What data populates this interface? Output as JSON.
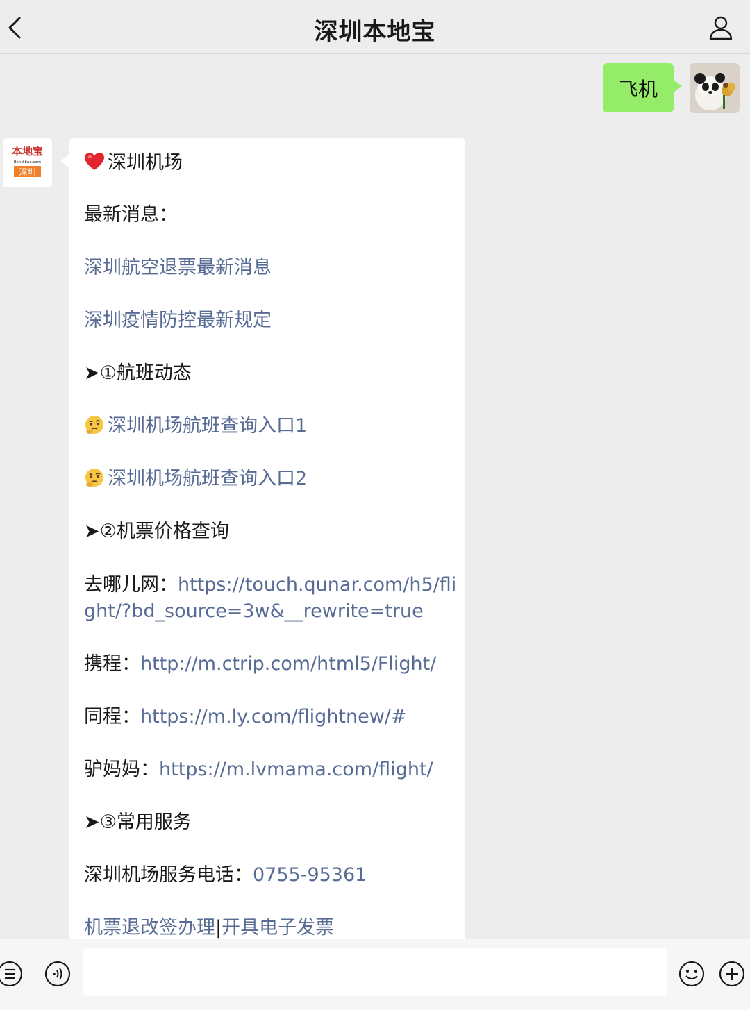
{
  "header": {
    "title": "深圳本地宝"
  },
  "chat": {
    "user_message": "飞机",
    "bot_avatar_text": {
      "line1": "本地宝",
      "line2": "Bendibao.com",
      "line3": "深圳"
    },
    "reply": {
      "heading": "深圳机场",
      "latest_label": "最新消息：",
      "latest_links": [
        "深圳航空退票最新消息",
        "深圳疫情防控最新规定"
      ],
      "section1": "➤①航班动态",
      "flight_links": [
        "深圳机场航班查询入口1",
        "深圳机场航班查询入口2"
      ],
      "section2": "➤②机票价格查询",
      "price_sites": [
        {
          "name": "去哪儿网：",
          "url": "https://touch.qunar.com/h5/flight/?bd_source=3w&__rewrite=true"
        },
        {
          "name": "携程：",
          "url": "http://m.ctrip.com/html5/Flight/"
        },
        {
          "name": "同程：",
          "url": "https://m.ly.com/flightnew/#"
        },
        {
          "name": "驴妈妈：",
          "url": "https://m.lvmama.com/flight/"
        }
      ],
      "section3": "➤③常用服务",
      "service_phone_label": "深圳机场服务电话：",
      "service_phone": "0755-95361",
      "last_link_a": "机票退改签办理",
      "last_link_sep": "|",
      "last_link_b": "开具电子发票"
    }
  },
  "icons": {
    "back": "chevron-left-icon",
    "profile": "person-icon",
    "menu": "list-icon",
    "voice": "voice-icon",
    "emoji": "smiley-icon",
    "plus": "plus-icon",
    "heart": "heart-icon",
    "thinking": "thinking-face-icon"
  },
  "colors": {
    "background": "#ededed",
    "user_bubble": "#95ec69",
    "bot_bubble": "#ffffff",
    "link": "#576b95"
  }
}
